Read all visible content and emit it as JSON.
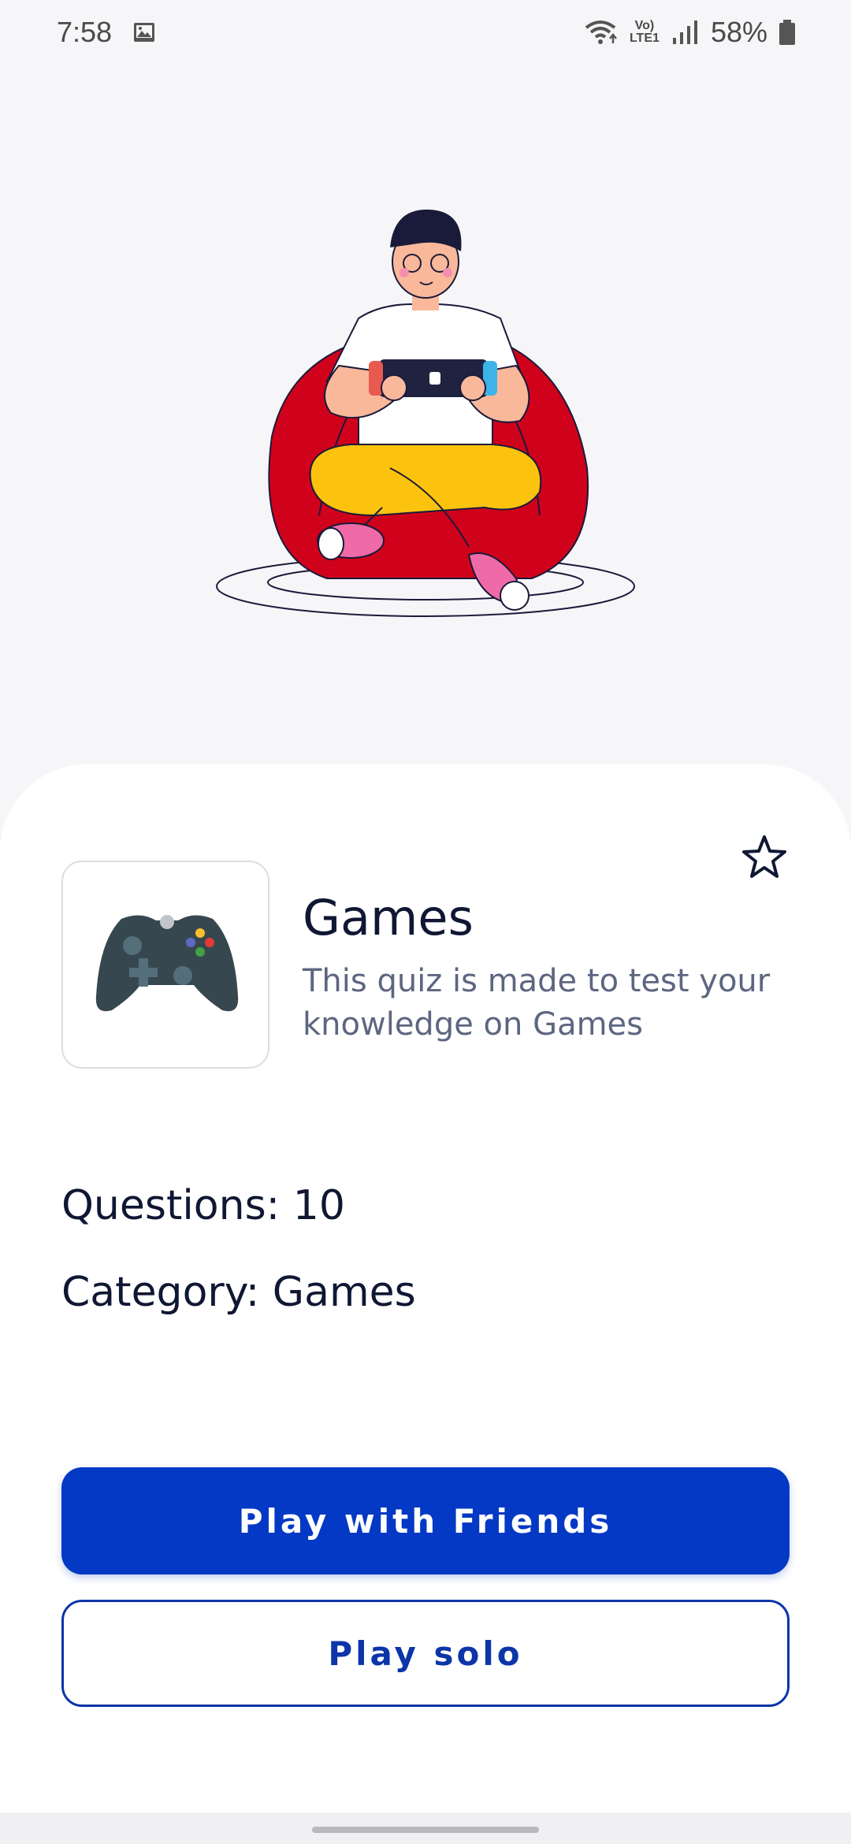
{
  "status_bar": {
    "time": "7:58",
    "network_label": "Vo) LTE1",
    "battery_percent": "58%"
  },
  "hero": {
    "illustration": "person-on-beanbag-playing-handheld-console"
  },
  "quiz": {
    "title": "Games",
    "description": "This quiz is made to test your knowledge on Games",
    "icon": "gamepad-icon",
    "questions_label": "Questions:",
    "questions_value": "10",
    "category_label": "Category:",
    "category_value": "Games"
  },
  "actions": {
    "play_friends_label": "Play with Friends",
    "play_solo_label": "Play solo"
  },
  "colors": {
    "primary": "#0339c4",
    "title_text": "#0f1733",
    "secondary_text": "#5d6680",
    "background": "#f6f6f9"
  }
}
